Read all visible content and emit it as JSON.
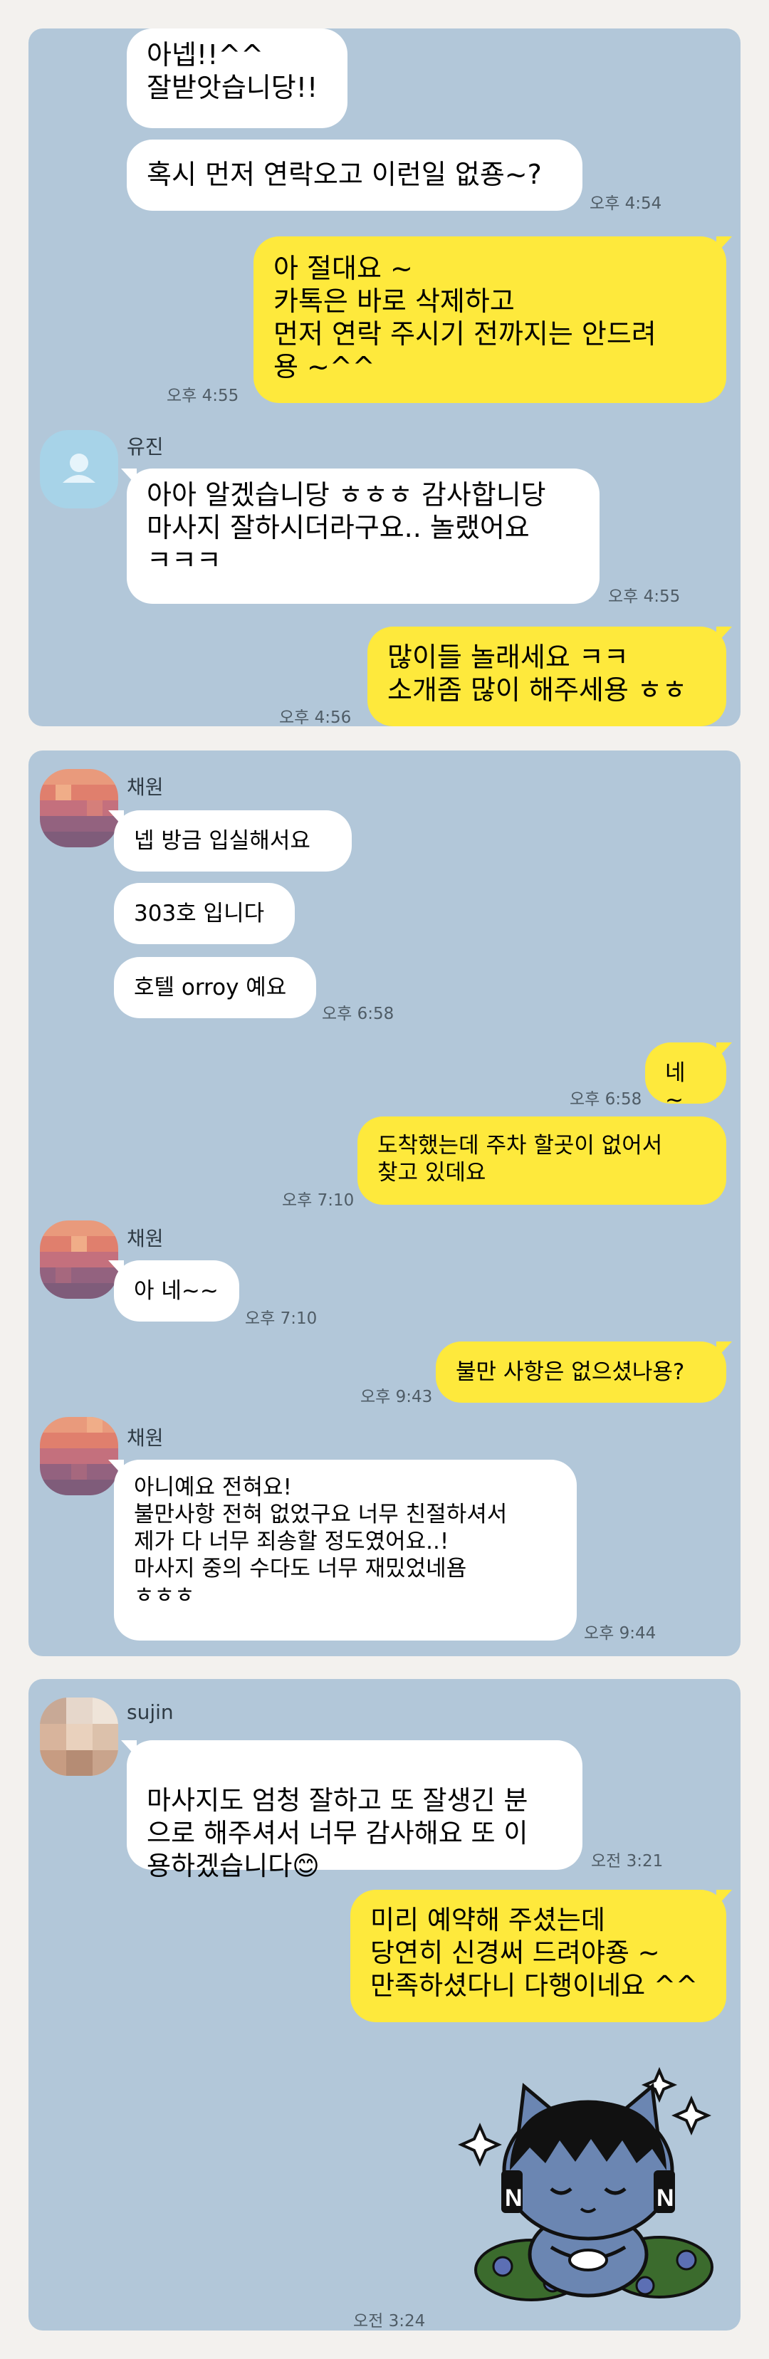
{
  "panel1": {
    "m1_text": "아넵!!^^\n잘받앗습니당!!",
    "m2_text": "혹시 먼저 연락오고 이런일 없죵~?",
    "m2_time": "오후 4:54",
    "m3_text": "아 절대요 ~\n카톡은 바로 삭제하고\n먼저 연락 주시기 전까지는 안드려\n용 ~^^",
    "m3_time": "오후 4:55",
    "sender": "유진",
    "m4_text": "아아 알겠습니당 ㅎㅎㅎ 감사합니당\n마사지 잘하시더라구요.. 놀랬어요\nㅋㅋㅋ",
    "m4_time": "오후 4:55",
    "m5_text": "많이들 놀래세요 ㅋㅋ\n소개좀 많이 해주세용 ㅎㅎ",
    "m5_time": "오후 4:56"
  },
  "panel2": {
    "sender": "채원",
    "m1_text": "넵 방금 입실해서요",
    "m2_text": "303호 입니다",
    "m3_text": "호텔 orroy 예요",
    "m3_time": "오후 6:58",
    "m4_text": "네 ~",
    "m4_time": "오후 6:58",
    "m5_text": "도착했는데  주차 할곳이 없어서\n찾고 있데요",
    "m5_time": "오후 7:10",
    "m6_text": "아 네~~",
    "m6_time": "오후 7:10",
    "m7_text": "불만 사항은 없으셨나용?",
    "m7_time": "오후 9:43",
    "m8_text": "아니예요 전혀요!\n불만사항 전혀 없었구요 너무 친절하셔서\n제가 다 너무 죄송할 정도였어요..!\n마사지 중의 수다도 너무 재밌었네욤\nㅎㅎㅎ",
    "m8_time": "오후 9:44"
  },
  "panel3": {
    "sender": "sujin",
    "m1_text": "마사지도 엄청 잘하고 또 잘생긴 분\n으로 해주셔서 너무 감사해요 또 이\n용하겠습니다",
    "m1_emoji": "😊",
    "m1_time": "오전 3:21",
    "m2_text": "미리 예약해 주셨는데\n당연히 신경써 드려야죵 ~\n만족하셨다니 다행이네요 ^^",
    "sticker": "sleeping-cat-sticker",
    "m2_time": "오전 3:24"
  },
  "colors": {
    "chat_bg": "#b2c7d9",
    "my_bubble": "#fee93c",
    "their_bubble": "#ffffff",
    "page_bg": "#f3f1ee"
  }
}
